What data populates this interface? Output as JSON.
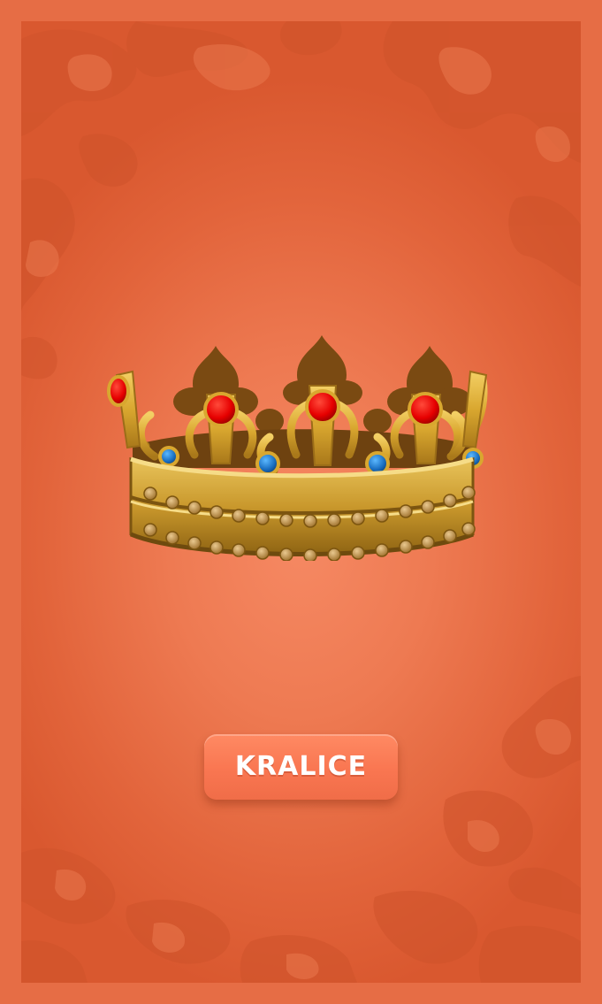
{
  "screen": {
    "accent_color": "#f97651",
    "background_color": "#e4693f"
  },
  "hero": {
    "icon": "crown-icon"
  },
  "action_button": {
    "label": "KRALICE"
  }
}
